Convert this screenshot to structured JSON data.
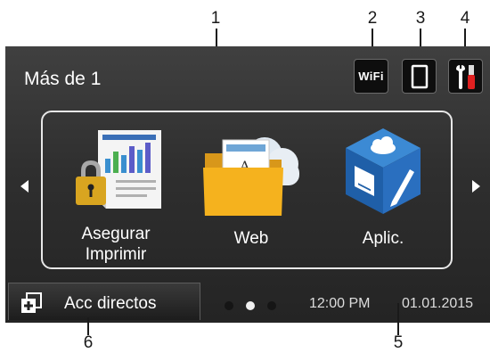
{
  "callouts": [
    "1",
    "2",
    "3",
    "4",
    "5",
    "6"
  ],
  "header": {
    "title": "Más de 1",
    "wifi_label": "WiFi",
    "icons": [
      "wifi-icon",
      "mobile-device-icon",
      "tools-settings-icon"
    ]
  },
  "apps": [
    {
      "label_line1": "Asegurar",
      "label_line2": "Imprimir",
      "icon": "secure-print-icon"
    },
    {
      "label_line1": "Web",
      "icon": "web-folder-icon"
    },
    {
      "label_line1": "Aplic.",
      "icon": "apps-cube-icon"
    }
  ],
  "footer": {
    "shortcut_label": "Acc directos",
    "page_count": 3,
    "active_page": 2,
    "time": "12:00 PM",
    "date": "01.01.2015"
  },
  "colors": {
    "screen_bg": "#2f2f2f",
    "text": "#ffffff",
    "tools_red": "#e02020",
    "folder_yellow": "#f5b21e",
    "cube_blue": "#1f5fa8"
  }
}
